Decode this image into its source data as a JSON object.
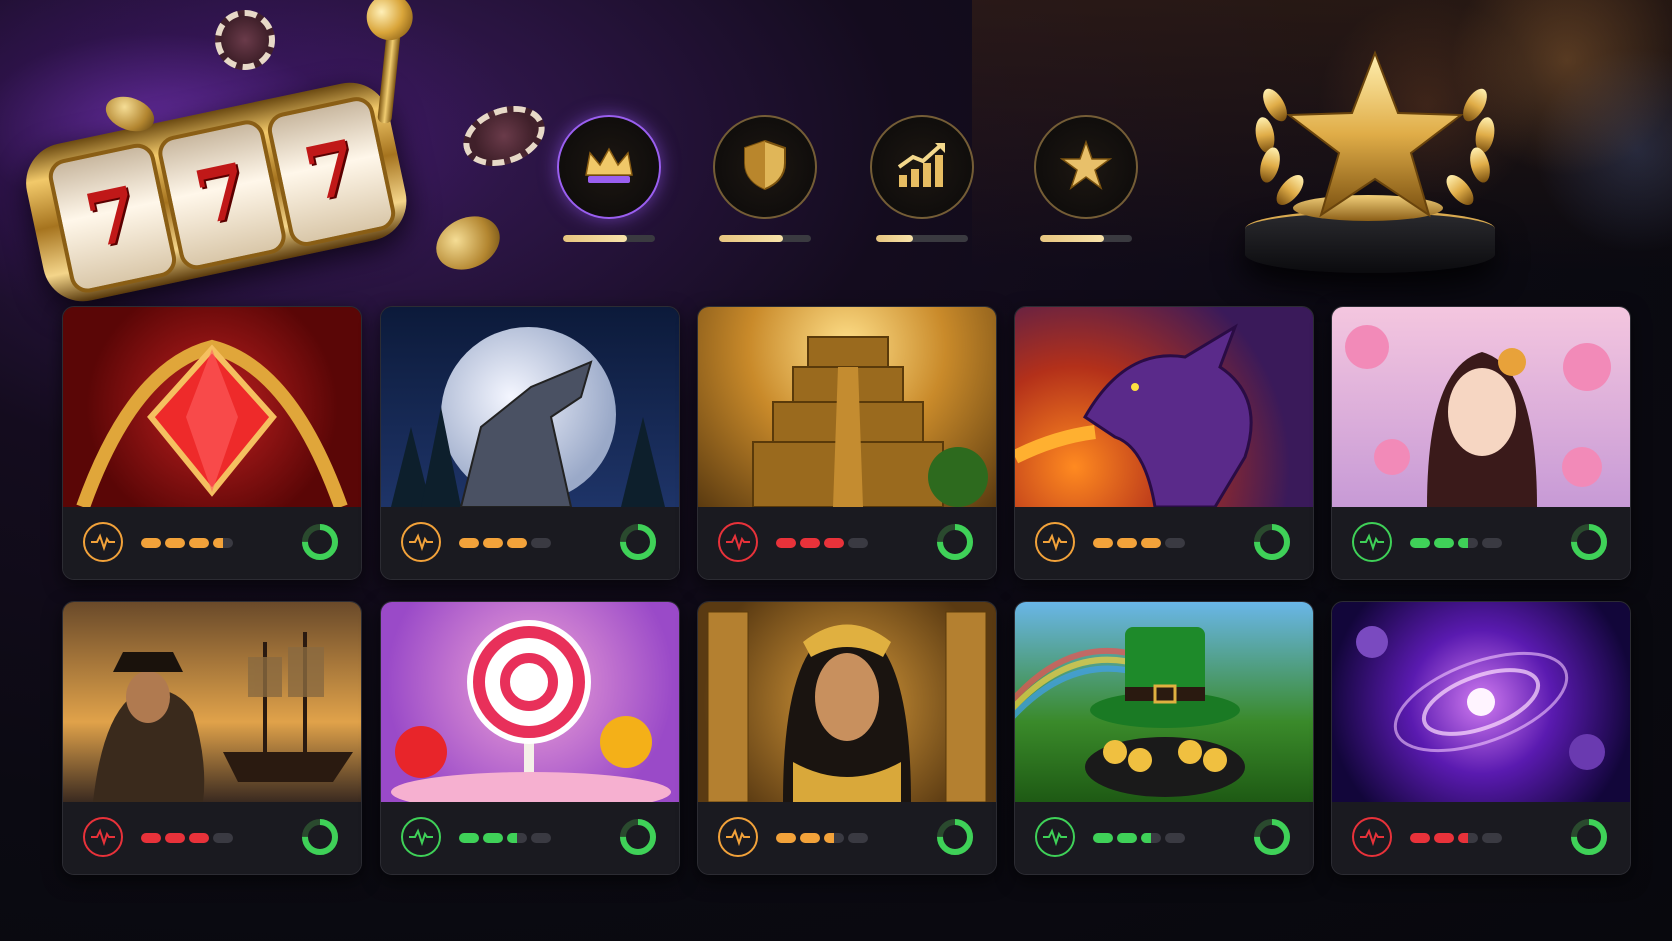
{
  "hero": {
    "slot_reels": [
      "7",
      "7",
      "7"
    ]
  },
  "features": [
    {
      "icon": "crown-icon",
      "active": true,
      "progress": 0.7
    },
    {
      "icon": "shield-icon",
      "active": false,
      "progress": 0.7
    },
    {
      "icon": "growth-chart-icon",
      "active": false,
      "progress": 0.4
    },
    {
      "icon": "star-icon",
      "active": false,
      "progress": 0.7
    }
  ],
  "colors": {
    "orange": "#f2a23a",
    "red": "#e8323a",
    "green": "#3fd158",
    "accent_purple": "#9a5ff0",
    "gold": "#e7c57f"
  },
  "games": [
    {
      "theme": "red-gem",
      "volatility_color": "orange",
      "volatility_level": 3.5,
      "rtp_ring": 0.75
    },
    {
      "theme": "moon-wolf",
      "volatility_color": "orange",
      "volatility_level": 3,
      "rtp_ring": 0.75
    },
    {
      "theme": "aztec-temple",
      "volatility_color": "red",
      "volatility_level": 3,
      "rtp_ring": 0.75
    },
    {
      "theme": "fire-dragon",
      "volatility_color": "orange",
      "volatility_level": 3,
      "rtp_ring": 0.75
    },
    {
      "theme": "blossom-princess",
      "volatility_color": "green",
      "volatility_level": 2.5,
      "rtp_ring": 0.75
    },
    {
      "theme": "pirate-ship",
      "volatility_color": "red",
      "volatility_level": 3,
      "rtp_ring": 0.75
    },
    {
      "theme": "candy-land",
      "volatility_color": "green",
      "volatility_level": 2.5,
      "rtp_ring": 0.75
    },
    {
      "theme": "egyptian-queen",
      "volatility_color": "orange",
      "volatility_level": 2.5,
      "rtp_ring": 0.75
    },
    {
      "theme": "leprechaun-gold",
      "volatility_color": "green",
      "volatility_level": 2.5,
      "rtp_ring": 0.75
    },
    {
      "theme": "cosmic-galaxy",
      "volatility_color": "red",
      "volatility_level": 2.5,
      "rtp_ring": 0.75
    }
  ]
}
